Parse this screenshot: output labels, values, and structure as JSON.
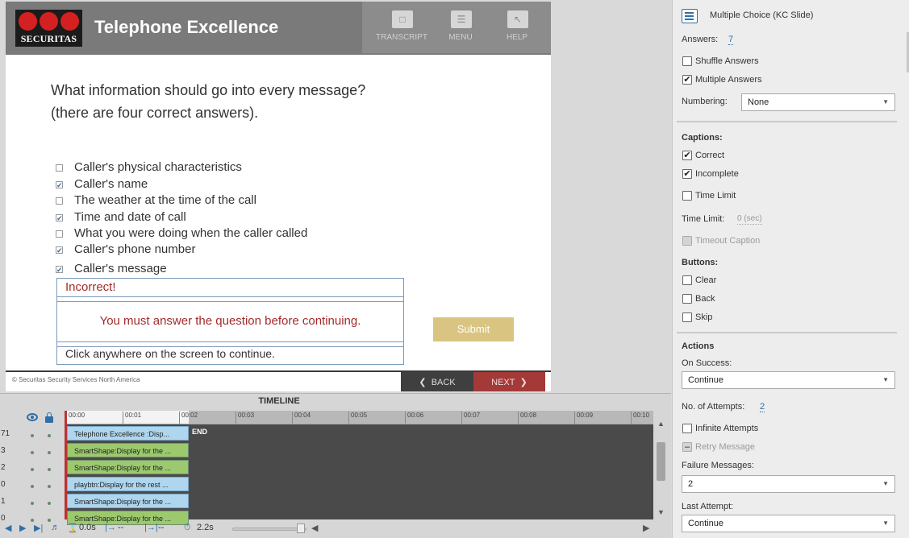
{
  "slide": {
    "header": {
      "logo_text": "SECURITAS",
      "title": "Telephone Excellence",
      "nav": [
        {
          "label": "TRANSCRIPT",
          "icon": "transcript-icon"
        },
        {
          "label": "MENU",
          "icon": "menu-icon"
        },
        {
          "label": "HELP",
          "icon": "help-icon"
        }
      ]
    },
    "question": {
      "line1": "What information should go into every message?",
      "line2": "(there are four correct answers)."
    },
    "options": [
      {
        "label": "Caller's physical characteristics",
        "checked": false
      },
      {
        "label": "Caller's name",
        "checked": true
      },
      {
        "label": "The weather at the time of the call",
        "checked": false
      },
      {
        "label": "Time and date of call",
        "checked": true
      },
      {
        "label": "What you were doing when the caller called",
        "checked": false
      },
      {
        "label": "Caller's phone number",
        "checked": true
      },
      {
        "label": "Caller's message",
        "checked": true
      }
    ],
    "feedback": {
      "incorrect": "Incorrect!",
      "message": "You must answer the question before continuing.",
      "continue": "Click anywhere on the screen to continue."
    },
    "submit_label": "Submit",
    "footer": {
      "copyright": "© Securitas Security Services North America",
      "back_label": "BACK",
      "next_label": "NEXT"
    }
  },
  "timeline": {
    "title": "TIMELINE",
    "ticks": [
      "00:00",
      "00:01",
      "00:02",
      "00:03",
      "00:04",
      "00:05",
      "00:06",
      "00:07",
      "00:08",
      "00:09",
      "00:10"
    ],
    "end_label": "END",
    "rows": [
      {
        "num": "71",
        "label": "Telephone Excellence :Disp...",
        "color": "blue"
      },
      {
        "num": "3",
        "label": "SmartShape:Display for the ...",
        "color": "green"
      },
      {
        "num": "2",
        "label": "SmartShape:Display for the ...",
        "color": "green"
      },
      {
        "num": "0",
        "label": "playbtn:Display for the rest ...",
        "color": "blue"
      },
      {
        "num": "1",
        "label": "SmartShape:Display for the ...",
        "color": "blue"
      },
      {
        "num": "0",
        "label": "SmartShape:Display for the ...",
        "color": "green"
      }
    ],
    "controls": {
      "current_time": "0.0s",
      "in_marker": "--",
      "out_marker": "--",
      "duration": "2.2s"
    }
  },
  "properties": {
    "title": "Multiple Choice (KC Slide)",
    "answers_label": "Answers:",
    "answers_value": "7",
    "shuffle_label": "Shuffle Answers",
    "shuffle_checked": false,
    "multiple_label": "Multiple Answers",
    "multiple_checked": true,
    "numbering_label": "Numbering:",
    "numbering_value": "None",
    "captions_heading": "Captions:",
    "correct_label": "Correct",
    "correct_checked": true,
    "incomplete_label": "Incomplete",
    "incomplete_checked": true,
    "time_limit_chk_label": "Time Limit",
    "time_limit_checked": false,
    "time_limit_label": "Time Limit:",
    "time_limit_value": "0 (sec)",
    "timeout_caption_label": "Timeout Caption",
    "buttons_heading": "Buttons:",
    "clear_label": "Clear",
    "back_label": "Back",
    "skip_label": "Skip",
    "actions_heading": "Actions",
    "on_success_label": "On Success:",
    "on_success_value": "Continue",
    "attempts_label": "No. of Attempts:",
    "attempts_value": "2",
    "infinite_label": "Infinite Attempts",
    "retry_label": "Retry Message",
    "failure_label": "Failure Messages:",
    "failure_value": "2",
    "last_attempt_label": "Last Attempt:",
    "last_attempt_value": "Continue"
  },
  "colors": {
    "brand_red": "#d42020",
    "accent_blue": "#2f6fa8",
    "feedback_red": "#a32a2a",
    "submit_gold": "#d9c581",
    "next_red": "#a33a38"
  }
}
